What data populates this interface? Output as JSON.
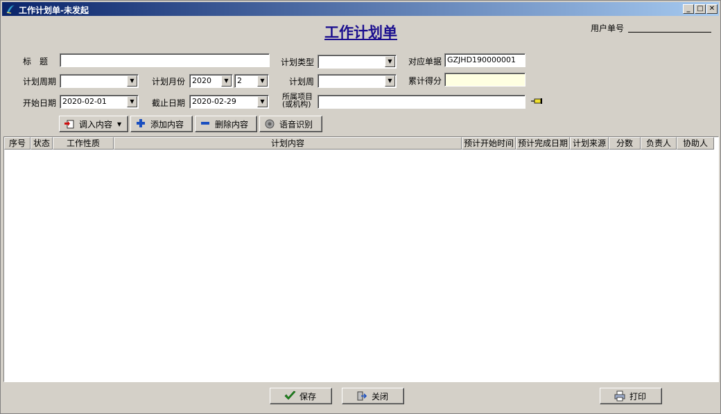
{
  "window": {
    "title": "工作计划单-未发起",
    "min_label": "_",
    "max_label": "□",
    "close_label": "✕"
  },
  "form": {
    "title": "工作计划单",
    "user_no_label": "用户单号",
    "fields": {
      "title_label": "标　题",
      "title_value": "",
      "plan_type_label": "计划类型",
      "plan_type_value": "",
      "ref_doc_label": "对应单据",
      "ref_doc_value": "GZJHD190000001",
      "period_label": "计划周期",
      "period_value": "",
      "month_label": "计划月份",
      "year_value": "2020",
      "month_value": "2",
      "week_label": "计划周",
      "week_value": "",
      "score_label": "累计得分",
      "score_value": "",
      "start_label": "开始日期",
      "start_value": "2020-02-01",
      "end_label": "截止日期",
      "end_value": "2020-02-29",
      "project_label_1": "所属项目",
      "project_label_2": "(或机构)",
      "project_value": ""
    }
  },
  "toolbar": {
    "import_label": "调入内容",
    "add_label": "添加内容",
    "delete_label": "删除内容",
    "voice_label": "语音识别"
  },
  "grid": {
    "columns": [
      "序号",
      "状态",
      "工作性质",
      "计划内容",
      "预计开始时间",
      "预计完成日期",
      "计划来源",
      "分数",
      "负责人",
      "协助人"
    ],
    "rows": []
  },
  "footer": {
    "save_label": "保存",
    "close_label": "关闭",
    "print_label": "打印"
  },
  "colors": {
    "accent": "#1b0f8f",
    "titlebar": "#0a246a",
    "face": "#d4d0c8",
    "highlight_field": "#ffffe1"
  }
}
